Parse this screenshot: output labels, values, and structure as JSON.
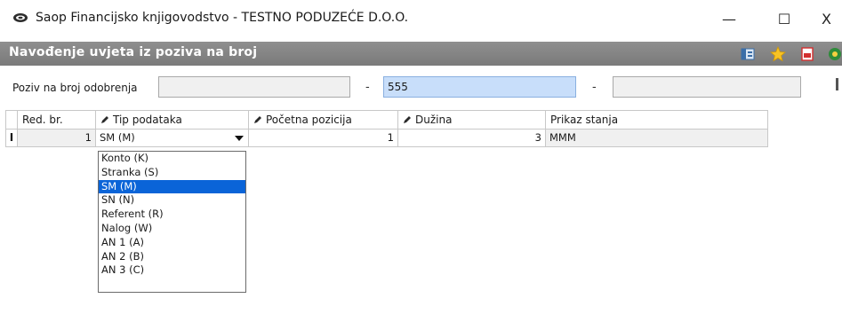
{
  "window": {
    "title": "Saop Financijsko knjigovodstvo - TESTNO PODUZEĆE D.O.O.",
    "minimize": "—",
    "maximize": "☐",
    "close": "X"
  },
  "form": {
    "title": "Navođenje uvjeta iz poziva na broj",
    "icons": [
      "layout-icon",
      "star-icon",
      "pdf-icon",
      "help-icon"
    ]
  },
  "poziv": {
    "label": "Poziv na broj odobrenja",
    "field1": "",
    "separator1": "-",
    "field2": "555",
    "separator2": "-",
    "field3": ""
  },
  "grid": {
    "columns": [
      "Red. br.",
      "Tip podataka",
      "Početna pozicija",
      "Dužina",
      "Prikaz stanja"
    ],
    "rows": [
      {
        "marker": "I",
        "red_br": "1",
        "tip": "SM (M)",
        "pocetna": "1",
        "duzina": "3",
        "prikaz": "MMM"
      }
    ]
  },
  "dropdown": {
    "items": [
      "Konto (K)",
      "Stranka (S)",
      "SM (M)",
      "SN (N)",
      "Referent (R)",
      "Nalog (W)",
      "AN 1 (A)",
      "AN 2 (B)",
      "AN 3 (C)"
    ],
    "selected_index": 2
  },
  "colors": {
    "header_band": "#808080",
    "selection": "#0a64d8",
    "active_field": "#c8defa"
  }
}
